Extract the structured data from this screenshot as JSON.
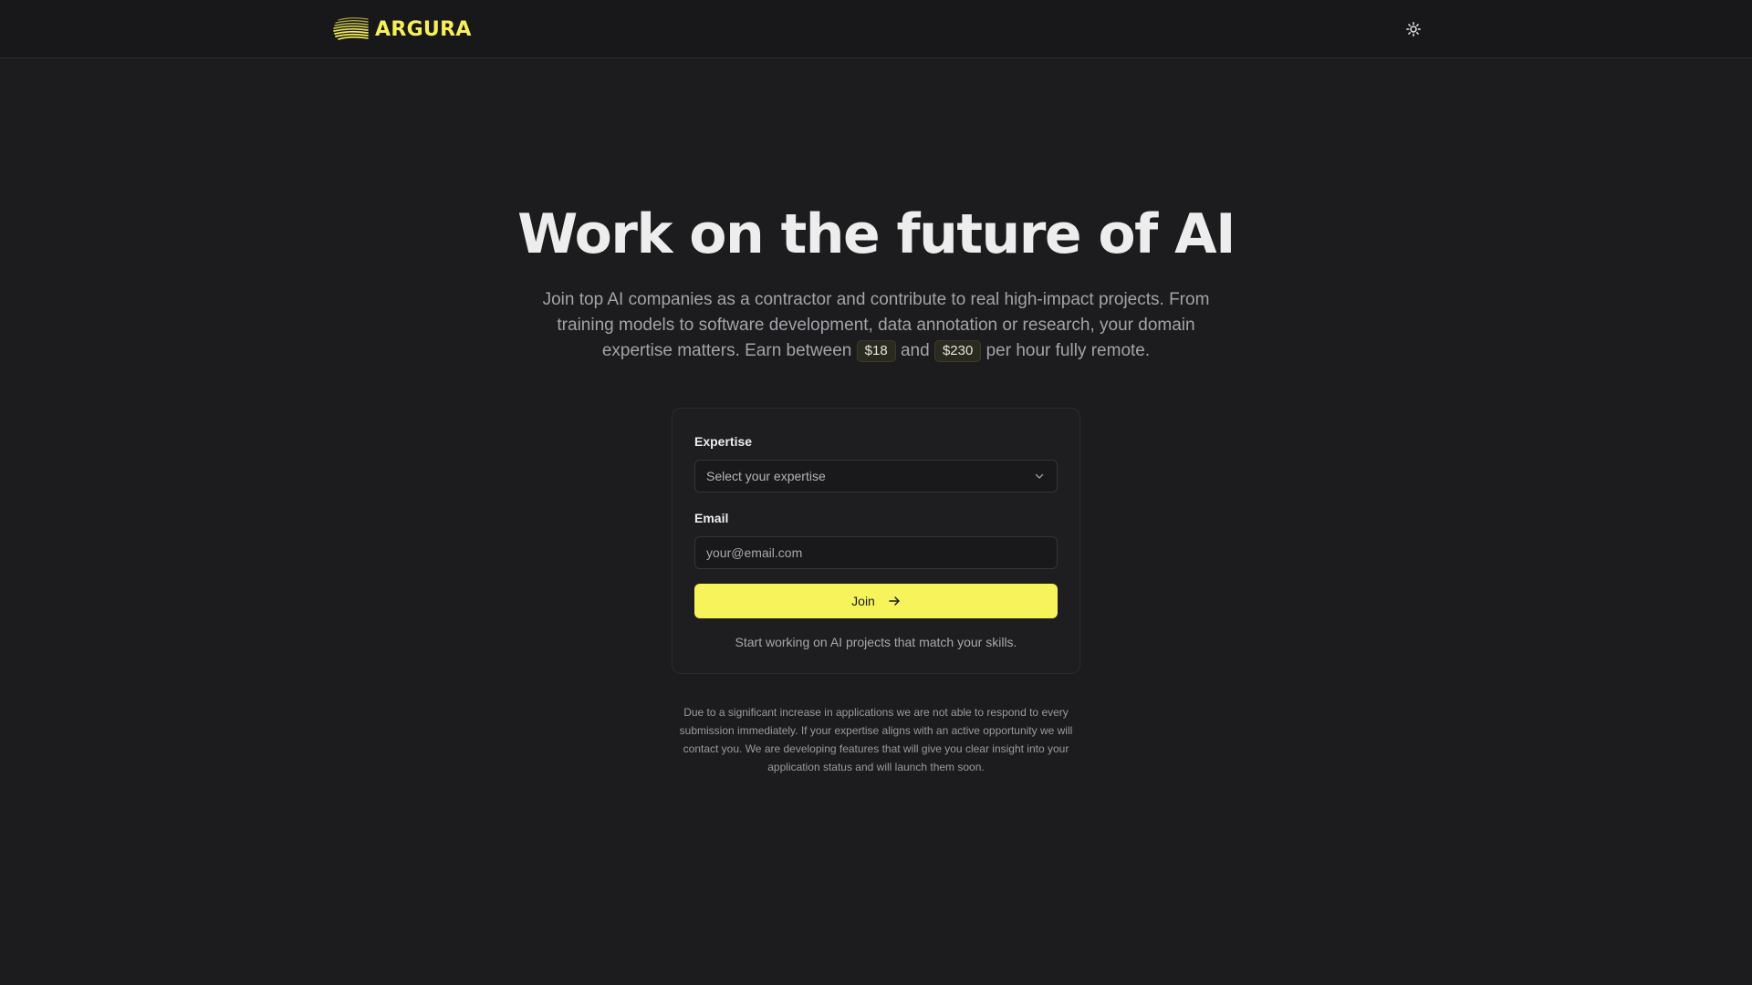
{
  "brand": {
    "name": "ARGURA",
    "accent_color": "#f7ef5a"
  },
  "header": {
    "theme_toggle_icon": "sun-icon"
  },
  "hero": {
    "title": "Work on the future of AI",
    "description_part1": "Join top AI companies as a contractor and contribute to real high-impact projects. From training models to software development, data annotation or research, your domain expertise matters. Earn between",
    "rate_min": "$18",
    "description_and": "and",
    "rate_max": "$230",
    "description_part2": "per hour fully remote."
  },
  "form": {
    "expertise_label": "Expertise",
    "expertise_placeholder": "Select your expertise",
    "email_label": "Email",
    "email_placeholder": "your@email.com",
    "email_value": "",
    "join_label": "Join",
    "note": "Start working on AI projects that match your skills."
  },
  "disclaimer": "Due to a significant increase in applications we are not able to respond to every submission immediately. If your expertise aligns with an active opportunity we will contact you. We are developing features that will give you clear insight into your application status and will launch them soon."
}
